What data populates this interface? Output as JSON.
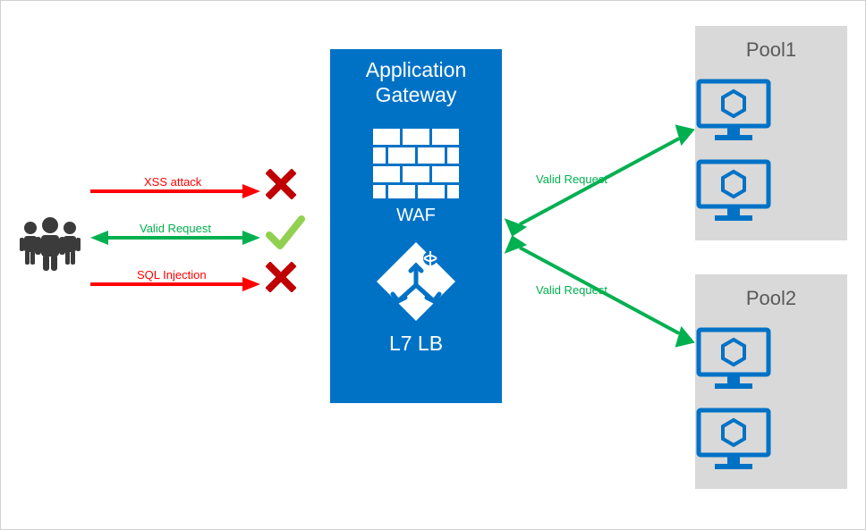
{
  "gateway": {
    "title_line1": "Application",
    "title_line2": "Gateway",
    "waf_label": "WAF",
    "lb_label": "L7 LB"
  },
  "pools": {
    "pool1_label": "Pool1",
    "pool2_label": "Pool2"
  },
  "traffic": {
    "xss_label": "XSS attack",
    "valid_label": "Valid Request",
    "sqli_label": "SQL Injection",
    "valid_to_pool1": "Valid Request",
    "valid_to_pool2": "Valid Request"
  },
  "colors": {
    "gateway_blue": "#0072C6",
    "pool_grey": "#d9d9d9",
    "arrow_green": "#00B050",
    "arrow_red": "#FF0000",
    "block_red": "#C00000",
    "azure_blue": "#0072C6"
  }
}
